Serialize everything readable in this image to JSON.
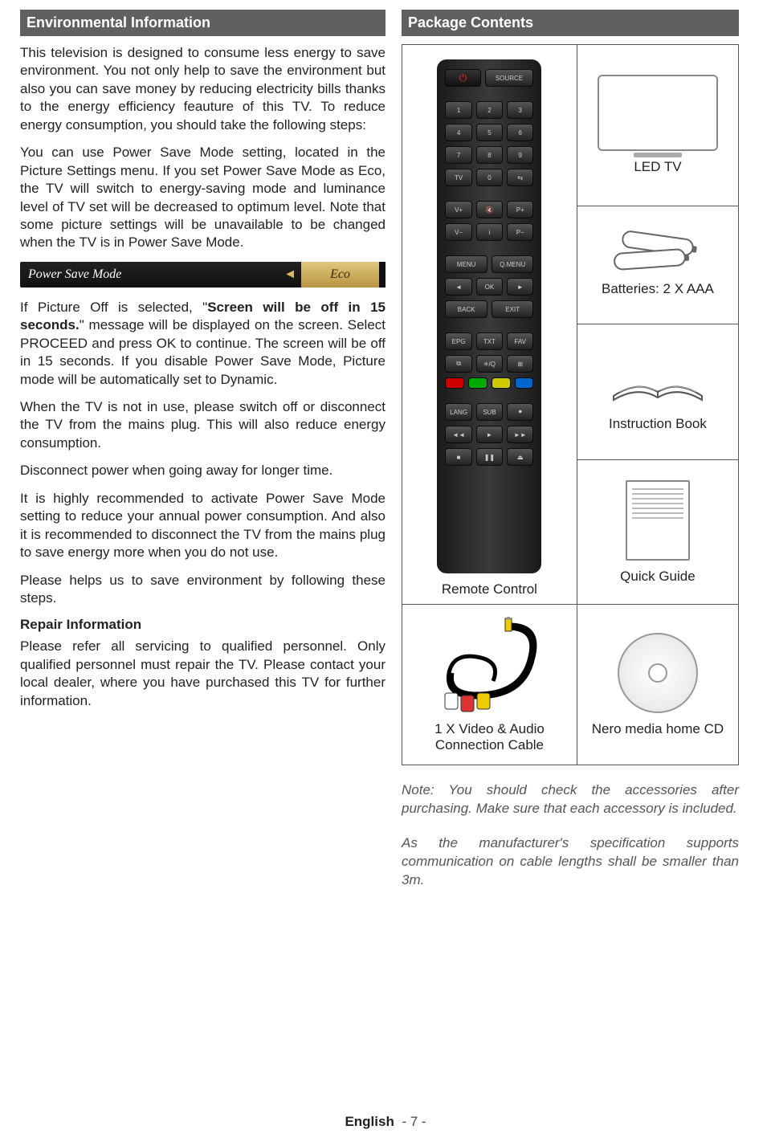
{
  "left": {
    "header": "Environmental Information",
    "p1": "This television is designed to consume less energy to save environment. You not only help to save the environment but also you can save money by reducing electricity bills thanks to the energy efficiency feauture of this TV. To reduce energy consumption, you should take the following steps:",
    "p2": "You can use Power Save Mode setting, located in the Picture Settings menu. If you set Power Save Mode as Eco, the TV will switch to energy-saving mode and luminance level of TV set will be decreased to optimum level. Note that some picture settings will be unavailable to be changed when the TV is in Power Save Mode.",
    "osd_label": "Power Save Mode",
    "osd_value": "Eco",
    "p3a": "If Picture Off is selected, \"",
    "p3b": "Screen will be off in 15 seconds.",
    "p3c": "\" message will be displayed on the screen. Select PROCEED and press OK to continue. The screen will be off in 15 seconds. If you disable Power Save Mode, Picture mode will be automatically set to Dynamic.",
    "p4": "When the TV is not in use, please switch off or disconnect the TV from the mains plug. This will also reduce energy consumption.",
    "p5": "Disconnect power when going away for longer time.",
    "p6": "It is highly recommended to activate Power Save Mode setting to reduce your annual power consumption. And also it is recommended to disconnect the TV from the mains plug to save energy more when you do not use.",
    "p7": "Please helps us to save environment by following these steps.",
    "repair_h": "Repair Information",
    "repair_p": "Please refer all servicing to qualified personnel. Only qualified personnel must repair the TV. Please contact your local dealer, where you have purchased this TV for further information."
  },
  "right": {
    "header": "Package Contents",
    "remote": "Remote Control",
    "tv": "LED TV",
    "batt": "Batteries: 2 X AAA",
    "book": "Instruction Book",
    "guide": "Quick Guide",
    "cable": "1 X Video & Audio Connection Cable",
    "cd": "Nero media home CD",
    "note1": "Note: You should check the accessories after purchasing. Make sure that each accessory is included.",
    "note2": "As the manufacturer's specification supports communication on cable lengths shall be smaller than 3m."
  },
  "footer": {
    "lang": "English",
    "page": "- 7 -"
  }
}
